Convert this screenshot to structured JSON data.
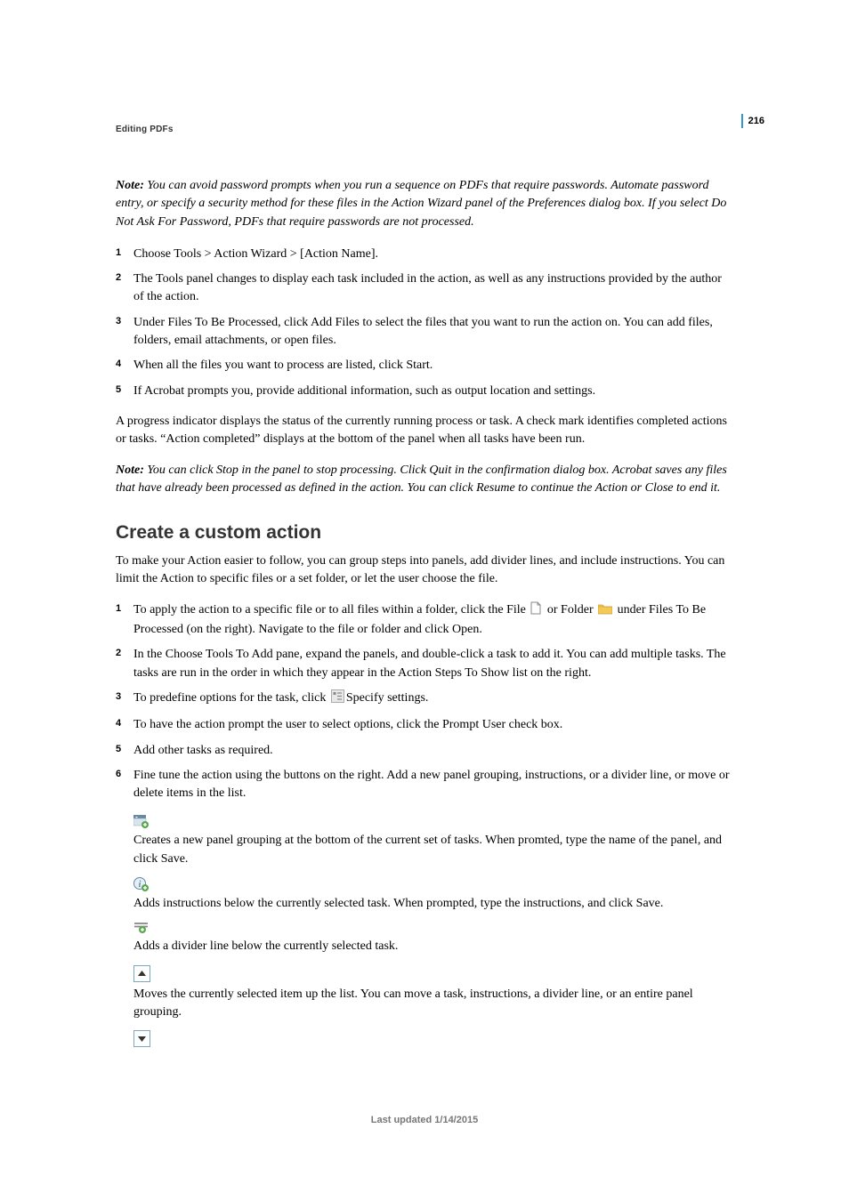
{
  "page_number": "216",
  "chapter_header": "Editing PDFs",
  "note1": {
    "label": "Note:",
    "text": " You can avoid password prompts when you run a sequence on PDFs that require passwords. Automate password entry, or specify a security method for these files in the Action Wizard panel of the Preferences dialog box. If you select Do Not Ask For Password, PDFs that require passwords are not processed."
  },
  "steps_a": [
    "Choose Tools > Action Wizard > [Action Name].",
    "The Tools panel changes to display each task included in the action, as well as any instructions provided by the author of the action.",
    "Under Files To Be Processed, click Add Files to select the files that you want to run the action on. You can add files, folders, email attachments, or open files.",
    "When all the files you want to process are listed, click Start.",
    "If Acrobat prompts you, provide additional information, such as output location and settings."
  ],
  "body1": "A progress indicator displays the status of the currently running process or task. A check mark identifies completed actions or tasks. “Action completed” displays at the bottom of the panel when all tasks have been run.",
  "note2": {
    "label": "Note:",
    "text": " You can click Stop in the panel to stop processing. Click Quit in the confirmation dialog box. Acrobat saves any files that have already been processed as defined in the action. You can click Resume to continue the Action or Close to end it."
  },
  "section_title": "Create a custom action",
  "body2": "To make your Action easier to follow, you can group steps into panels, add divider lines, and include instructions. You can limit the Action to specific files or a set folder, or let the user choose the file.",
  "step_b1": {
    "pre": "To apply the action to a specific file or to all files within a folder, click the File ",
    "mid": " or Folder ",
    "post": " under Files To Be Processed (on the right). Navigate to the file or folder and click Open."
  },
  "step_b2": "In the Choose Tools To Add pane, expand the panels, and double-click a task to add it. You can add multiple tasks. The tasks are run in the order in which they appear in the Action Steps To Show list on the right.",
  "step_b3": {
    "pre": "To predefine options for the task, click ",
    "post": "Specify settings."
  },
  "step_b4": "To have the action prompt the user to select options, click the Prompt User check box.",
  "step_b5": "Add other tasks as required.",
  "step_b6": "Fine tune the action using the buttons on the right. Add a new panel grouping, instructions, or a divider line, or move or delete items in the list.",
  "desc": {
    "panel": "Creates a new panel grouping at the bottom of the current set of tasks. When promted, type the name of the panel, and click Save.",
    "instructions": "Adds instructions below the currently selected task. When prompted, type the instructions, and click Save.",
    "divider": "Adds a divider line below the currently selected task.",
    "moveup": "Moves the currently selected item up the list. You can move a task, instructions, a divider line, or an entire panel grouping."
  },
  "footer": "Last updated 1/14/2015"
}
